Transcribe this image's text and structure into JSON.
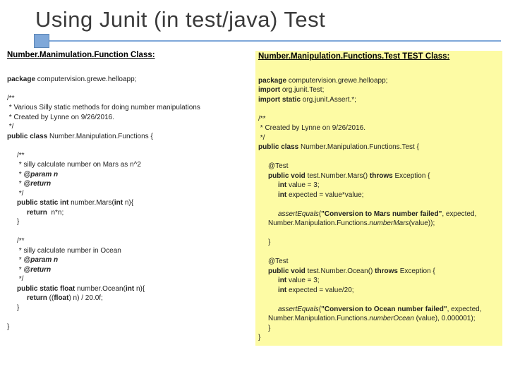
{
  "title": "Using Junit (in test/java) Test",
  "left": {
    "header": "Number.Manimulation.Function Class:",
    "pkg": "package",
    "pkg_val": " computervision.grewe.helloapp;",
    "c1": "/**",
    "c2": " * Various Silly static methods for doing number manipulations",
    "c3": " * Created by Lynne on 9/26/2016.",
    "c4": " */",
    "cls": "public class ",
    "cls_name": "Number.Manipulation.Functions {",
    "m1_c1": "/**",
    "m1_c2": " * silly calculate number on Mars as n^2",
    "m1_c3": " * ",
    "m1_c3b": "@param n",
    "m1_c4": " * ",
    "m1_c4b": "@return",
    "m1_c5": " */",
    "m1_sig_a": "public static int ",
    "m1_sig_b": "number.Mars(",
    "m1_sig_c": "int ",
    "m1_sig_d": "n){",
    "m1_body_a": "return  ",
    "m1_body_b": "n*n;",
    "m1_close": "}",
    "m2_c1": "/**",
    "m2_c2": " * silly calculate number in Ocean",
    "m2_c3": " * ",
    "m2_c3b": "@param n",
    "m2_c4": " * ",
    "m2_c4b": "@return",
    "m2_c5": " */",
    "m2_sig_a": "public static float ",
    "m2_sig_b": "number.Ocean(",
    "m2_sig_c": "int ",
    "m2_sig_d": "n){",
    "m2_body_a": "return ",
    "m2_body_b": "((",
    "m2_body_c": "float",
    "m2_body_d": ") n) / 20.0f;",
    "m2_close": "}",
    "cls_close": "}"
  },
  "right": {
    "header": "Number.Manipulation.Functions.Test TEST Class:",
    "pkg": "package",
    "pkg_val": " computervision.grewe.helloapp;",
    "imp1a": "import ",
    "imp1b": "org.junit.Test;",
    "imp2a": "import static ",
    "imp2b": "org.junit.Assert.*;",
    "c1": "/**",
    "c2": " * Created by Lynne on 9/26/2016.",
    "c3": " */",
    "cls": "public class ",
    "cls_name": "Number.Manipulation.Functions.Test {",
    "t1_ann": "@Test",
    "t1_sig_a": "public void ",
    "t1_sig_b": "test.Number.Mars() ",
    "t1_sig_c": "throws ",
    "t1_sig_d": "Exception {",
    "t1_l1a": "int ",
    "t1_l1b": "value = 3;",
    "t1_l2a": "int ",
    "t1_l2b": "expected = value*value;",
    "t1_l3a": "assertEquals",
    "t1_l3b": "(",
    "t1_l3c": "\"Conversion to Mars number failed\"",
    "t1_l3d": ", expected, Number.Manipulation.Functions.",
    "t1_l3e": "numberMars",
    "t1_l3f": "(value));",
    "t1_close": "}",
    "t2_ann": "@Test",
    "t2_sig_a": "public void ",
    "t2_sig_b": "test.Number.Ocean() ",
    "t2_sig_c": "throws ",
    "t2_sig_d": "Exception {",
    "t2_l1a": "int ",
    "t2_l1b": "value = 3;",
    "t2_l2a": "int ",
    "t2_l2b": "expected = value/20;",
    "t2_l3a": "assertEquals",
    "t2_l3b": "(",
    "t2_l3c": "\"Conversion to Ocean number failed\"",
    "t2_l3d": ", expected, Number.Manipulation.Functions.",
    "t2_l3e": "numberOcean",
    "t2_l3f": " (value), 0.000001);",
    "t2_close": "}",
    "cls_close": "}"
  }
}
